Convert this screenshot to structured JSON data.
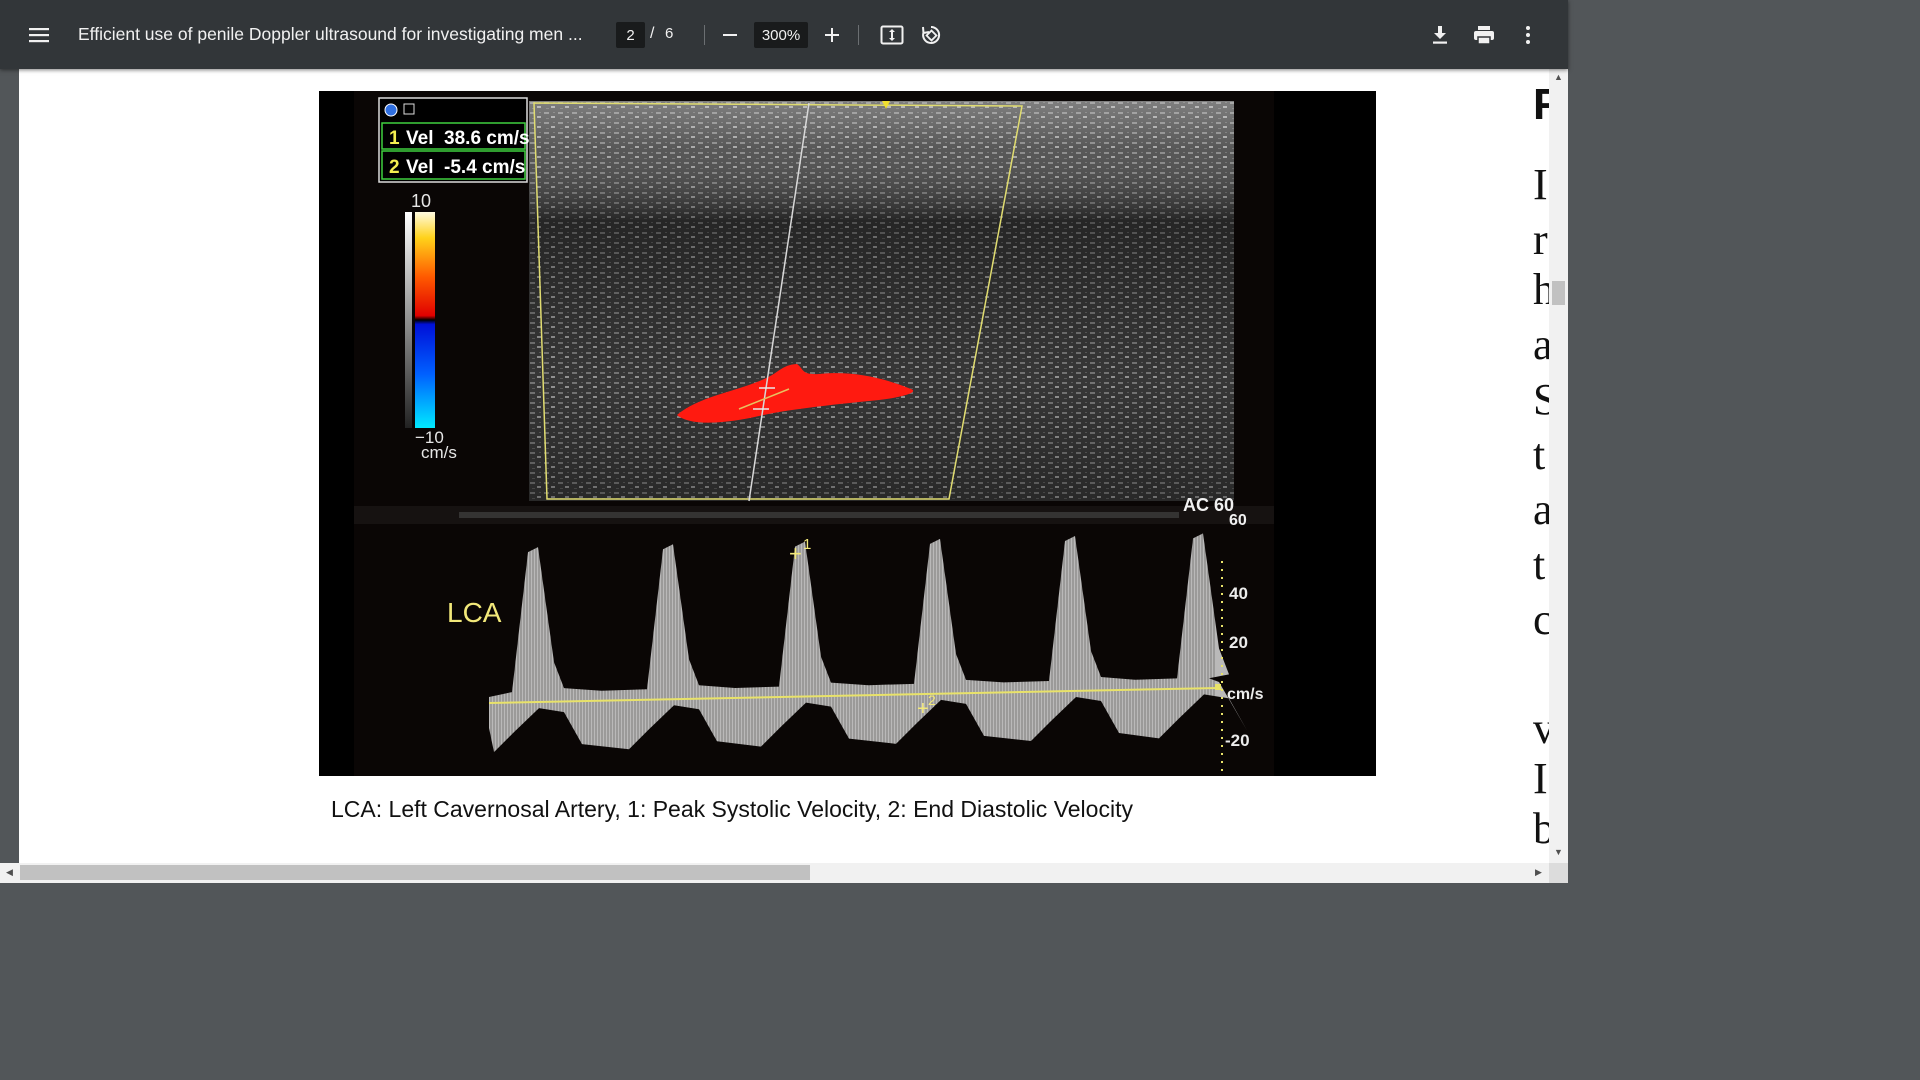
{
  "toolbar": {
    "title": "Efficient use of penile Doppler ultrasound for investigating men ...",
    "current_page": "2",
    "page_separator": "/",
    "total_pages": "6",
    "zoom": "300%"
  },
  "icons": {
    "menu": "menu-icon",
    "zoom_out": "minus-icon",
    "zoom_in": "plus-icon",
    "fit": "fit-to-page-icon",
    "rotate": "rotate-icon",
    "download": "download-icon",
    "print": "print-icon",
    "more": "more-vertical-icon"
  },
  "figure": {
    "measurement_1_index": "1",
    "measurement_1": "Vel  38.6 cm/s",
    "measurement_2_index": "2",
    "measurement_2": "Vel  -5.4 cm/s",
    "color_scale_top": "10",
    "color_scale_bottom": "−10",
    "color_scale_unit": "cm/s",
    "ac_label": "AC 60",
    "ac_value": "60",
    "vessel_label": "LCA",
    "spectral_scale": [
      "40",
      "20",
      "cm/s",
      "-20"
    ],
    "marker_1": "1",
    "marker_2": "2"
  },
  "caption": "LCA: Left Cavernosal Artery, 1: Peak Systolic Velocity, 2: End Diastolic Velocity",
  "colors": {
    "toolbar_bg": "#323639",
    "viewer_bg": "#525659",
    "doppler_yellow": "#e8e26a",
    "flow_red": "#ff1a10"
  }
}
